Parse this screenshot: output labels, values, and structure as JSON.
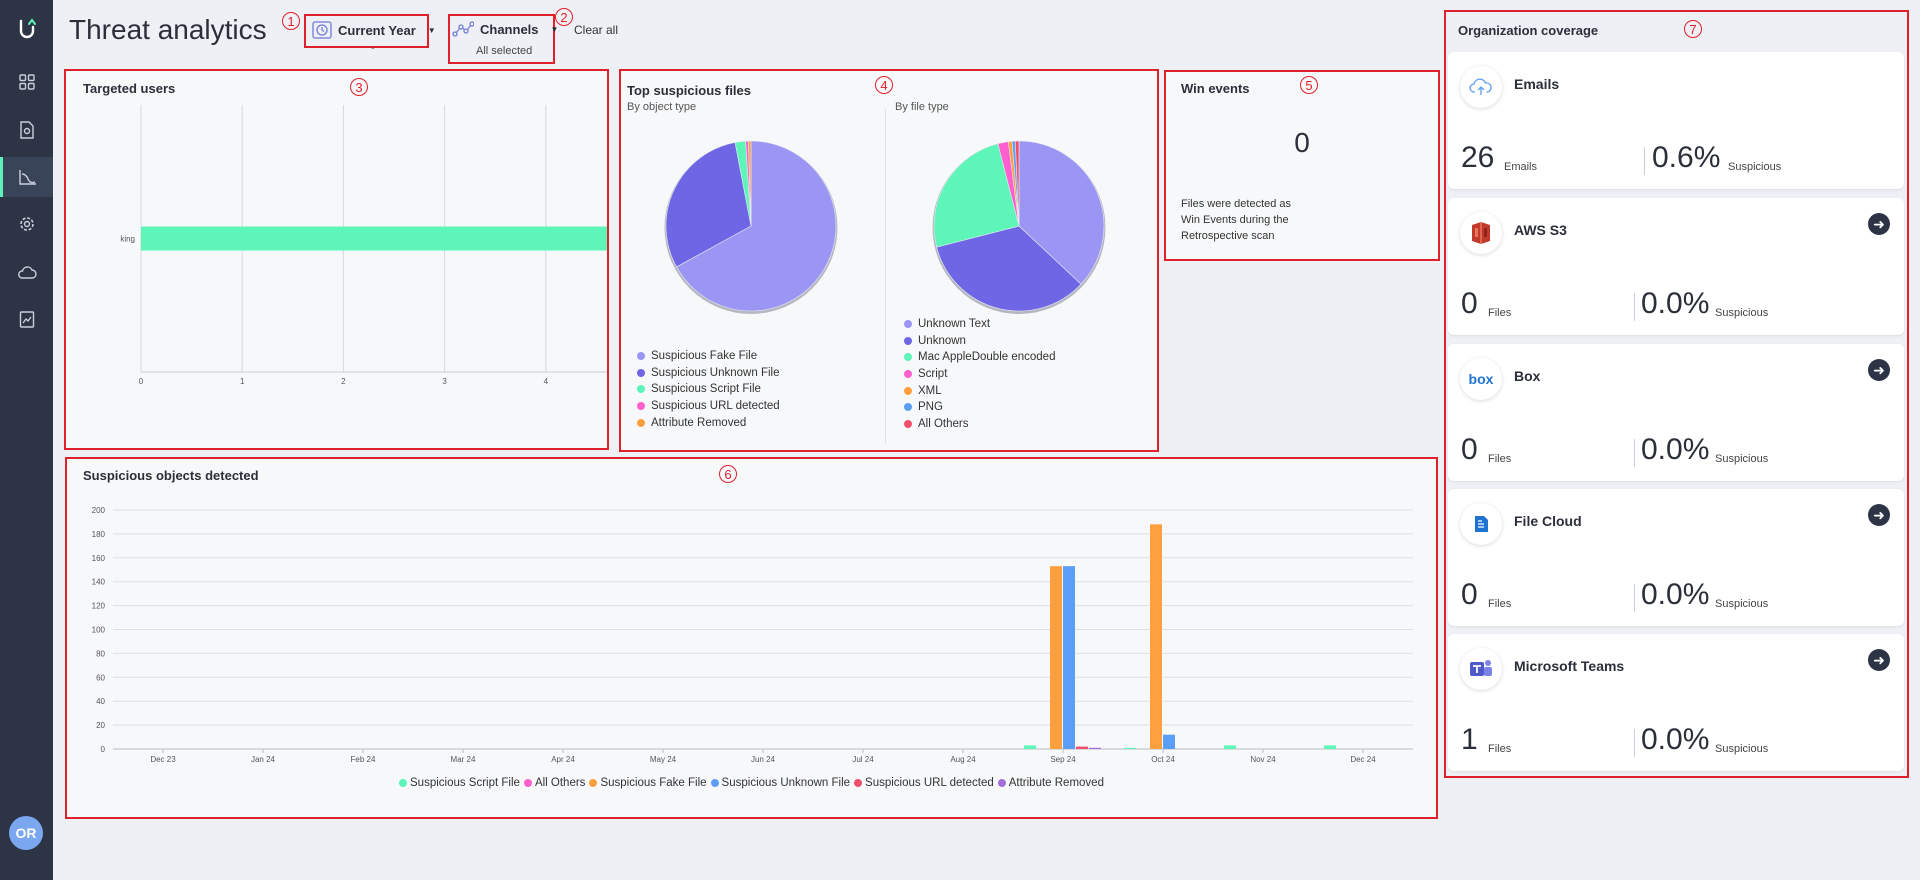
{
  "page": {
    "title": "Threat analytics"
  },
  "sidebar": {
    "logo_icon": "logo-icon",
    "avatar": "OR",
    "items": [
      {
        "icon": "dashboard-icon",
        "active": false
      },
      {
        "icon": "file-scan-icon",
        "active": false
      },
      {
        "icon": "analytics-chart-icon",
        "active": true
      },
      {
        "icon": "gear-icon",
        "active": false
      },
      {
        "icon": "cloud-icon",
        "active": false
      },
      {
        "icon": "report-icon",
        "active": false
      }
    ]
  },
  "filters": {
    "period_label": "Current Year",
    "period_sub": "-",
    "channels_label": "Channels",
    "channels_sub": "All selected",
    "clear_all": "Clear all"
  },
  "markers": [
    "1",
    "2",
    "3",
    "4",
    "5",
    "6",
    "7"
  ],
  "targeted_users": {
    "title": "Targeted users",
    "chart_data": {
      "type": "bar",
      "orientation": "horizontal",
      "categories": [
        "king"
      ],
      "values": [
        5
      ],
      "xticks": [
        "0",
        "1",
        "2",
        "3",
        "4"
      ],
      "xlim": [
        0,
        5
      ],
      "color": "#5ef5b8"
    }
  },
  "top_files": {
    "title": "Top suspicious files",
    "by_object": {
      "subtitle": "By object type",
      "chart_data": {
        "type": "pie",
        "labels": [
          "Suspicious Fake File",
          "Suspicious Unknown File",
          "Suspicious Script File",
          "Suspicious URL detected",
          "Attribute Removed"
        ],
        "values": [
          67,
          30,
          2,
          0.5,
          0.5
        ],
        "colors": [
          "#9b95f4",
          "#6f66e6",
          "#5ef5b8",
          "#ff5fcf",
          "#ff9f3d"
        ]
      }
    },
    "by_file": {
      "subtitle": "By file type",
      "chart_data": {
        "type": "pie",
        "labels": [
          "Unknown Text",
          "Unknown",
          "Mac AppleDouble encoded",
          "Script",
          "XML",
          "PNG",
          "All Others"
        ],
        "values": [
          37,
          34,
          25,
          2,
          0.7,
          0.6,
          0.7
        ],
        "colors": [
          "#9b95f4",
          "#6f66e6",
          "#5ef5b8",
          "#ff5fcf",
          "#ff9f3d",
          "#5a9ff5",
          "#f0506e"
        ]
      }
    }
  },
  "win_events": {
    "title": "Win events",
    "count": "0",
    "description_lines": [
      "Files were detected as",
      "Win Events during the",
      "Retrospective scan"
    ]
  },
  "suspicious_objects": {
    "title": "Suspicious objects detected",
    "chart_data": {
      "type": "bar",
      "categories": [
        "Dec 23",
        "Jan 24",
        "Feb 24",
        "Mar 24",
        "Apr 24",
        "May 24",
        "Jun 24",
        "Jul 24",
        "Aug 24",
        "Sep 24",
        "Oct 24",
        "Nov 24",
        "Dec 24"
      ],
      "ylim": [
        0,
        200
      ],
      "yticks": [
        0,
        20,
        40,
        60,
        80,
        100,
        120,
        140,
        160,
        180,
        200
      ],
      "series": [
        {
          "name": "Suspicious Script File",
          "color": "#5ef5b8",
          "values": [
            0,
            0,
            0,
            0,
            0,
            0,
            0,
            0,
            0,
            3,
            1,
            3,
            3
          ]
        },
        {
          "name": "All Others",
          "color": "#ff5fcf",
          "values": [
            0,
            0,
            0,
            0,
            0,
            0,
            0,
            0,
            0,
            0,
            0,
            0,
            0
          ]
        },
        {
          "name": "Suspicious Fake File",
          "color": "#ff9f3d",
          "values": [
            0,
            0,
            0,
            0,
            0,
            0,
            0,
            0,
            0,
            153,
            188,
            0,
            0
          ]
        },
        {
          "name": "Suspicious Unknown File",
          "color": "#5a9ff5",
          "values": [
            0,
            0,
            0,
            0,
            0,
            0,
            0,
            0,
            0,
            153,
            12,
            0,
            0
          ]
        },
        {
          "name": "Suspicious URL detected",
          "color": "#f0506e",
          "values": [
            0,
            0,
            0,
            0,
            0,
            0,
            0,
            0,
            0,
            2,
            0,
            0,
            0
          ]
        },
        {
          "name": "Attribute Removed",
          "color": "#a36fd6",
          "values": [
            0,
            0,
            0,
            0,
            0,
            0,
            0,
            0,
            0,
            1,
            0,
            0,
            0
          ]
        }
      ]
    }
  },
  "coverage": {
    "title": "Organization coverage",
    "cards": [
      {
        "icon": "cloud-upload-icon",
        "name": "Emails",
        "count": "26",
        "unit": "Emails",
        "percent": "0.6%",
        "percent_label": "Suspicious",
        "has_arrow": false
      },
      {
        "icon": "aws-s3-icon",
        "name": "AWS S3",
        "count": "0",
        "unit": "Files",
        "percent": "0.0%",
        "percent_label": "Suspicious",
        "has_arrow": true
      },
      {
        "icon": "box-icon",
        "name": "Box",
        "icon_text": "box",
        "count": "0",
        "unit": "Files",
        "percent": "0.0%",
        "percent_label": "Suspicious",
        "has_arrow": true
      },
      {
        "icon": "file-cloud-icon",
        "name": "File Cloud",
        "count": "0",
        "unit": "Files",
        "percent": "0.0%",
        "percent_label": "Suspicious",
        "has_arrow": true
      },
      {
        "icon": "microsoft-teams-icon",
        "name": "Microsoft Teams",
        "count": "1",
        "unit": "Files",
        "percent": "0.0%",
        "percent_label": "Suspicious",
        "has_arrow": true
      }
    ]
  },
  "colors": {
    "accent": "#5ef5b8",
    "sidebar": "#2c3446",
    "annotation": "#e0202a"
  }
}
